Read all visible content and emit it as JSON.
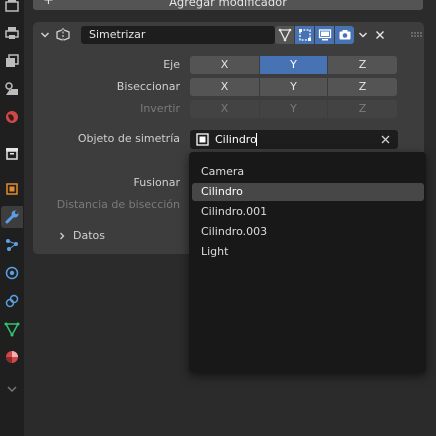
{
  "toolbar": {
    "add_modifier_label": "Agregar modificador",
    "add_modifier_icon": "plus-icon"
  },
  "tabs": [
    {
      "id": "render",
      "icon": "render-camera-icon",
      "color": "#bdbdbd"
    },
    {
      "id": "output",
      "icon": "printer-icon",
      "color": "#bdbdbd"
    },
    {
      "id": "view-layer",
      "icon": "image-stack-icon",
      "color": "#bdbdbd"
    },
    {
      "id": "scene",
      "icon": "scene-icon",
      "color": "#bdbdbd"
    },
    {
      "id": "world",
      "icon": "world-icon",
      "color": "#d04848"
    },
    {
      "id": "collection",
      "icon": "collection-box-icon",
      "color": "#e6e6e6"
    },
    {
      "id": "object",
      "icon": "object-square-icon",
      "color": "#e38a2e"
    },
    {
      "id": "modifiers",
      "icon": "wrench-icon",
      "color": "#5a9fe3",
      "active": true
    },
    {
      "id": "particles",
      "icon": "particles-icon",
      "color": "#5a9fe3"
    },
    {
      "id": "physics",
      "icon": "physics-orbit-icon",
      "color": "#5a9fe3"
    },
    {
      "id": "constraints",
      "icon": "constraints-icon",
      "color": "#5a9fe3"
    },
    {
      "id": "data",
      "icon": "mesh-triangle-icon",
      "color": "#31c46e"
    },
    {
      "id": "material",
      "icon": "material-sphere-icon",
      "color": "#d04848"
    },
    {
      "id": "more",
      "icon": "chevron-down-icon",
      "color": "#777777"
    }
  ],
  "modifier": {
    "name": "Simetrizar",
    "accent": "#4772b3",
    "axis": {
      "label": "Eje",
      "options": [
        "X",
        "Y",
        "Z"
      ],
      "active": "Y"
    },
    "bisect": {
      "label": "Biseccionar",
      "options": [
        "X",
        "Y",
        "Z"
      ]
    },
    "flip": {
      "label": "Invertir",
      "options": [
        "X",
        "Y",
        "Z"
      ],
      "disabled": true
    },
    "mirror_object": {
      "label": "Objeto de simetría",
      "value": "Cilindro"
    },
    "merge_label": "Fusionar",
    "bisect_distance_label": "Distancia de bisección",
    "data_panel_label": "Datos"
  },
  "dropdown": {
    "items": [
      "Camera",
      "Cilindro",
      "Cilindro.001",
      "Cilindro.003",
      "Light"
    ],
    "highlighted": "Cilindro"
  }
}
